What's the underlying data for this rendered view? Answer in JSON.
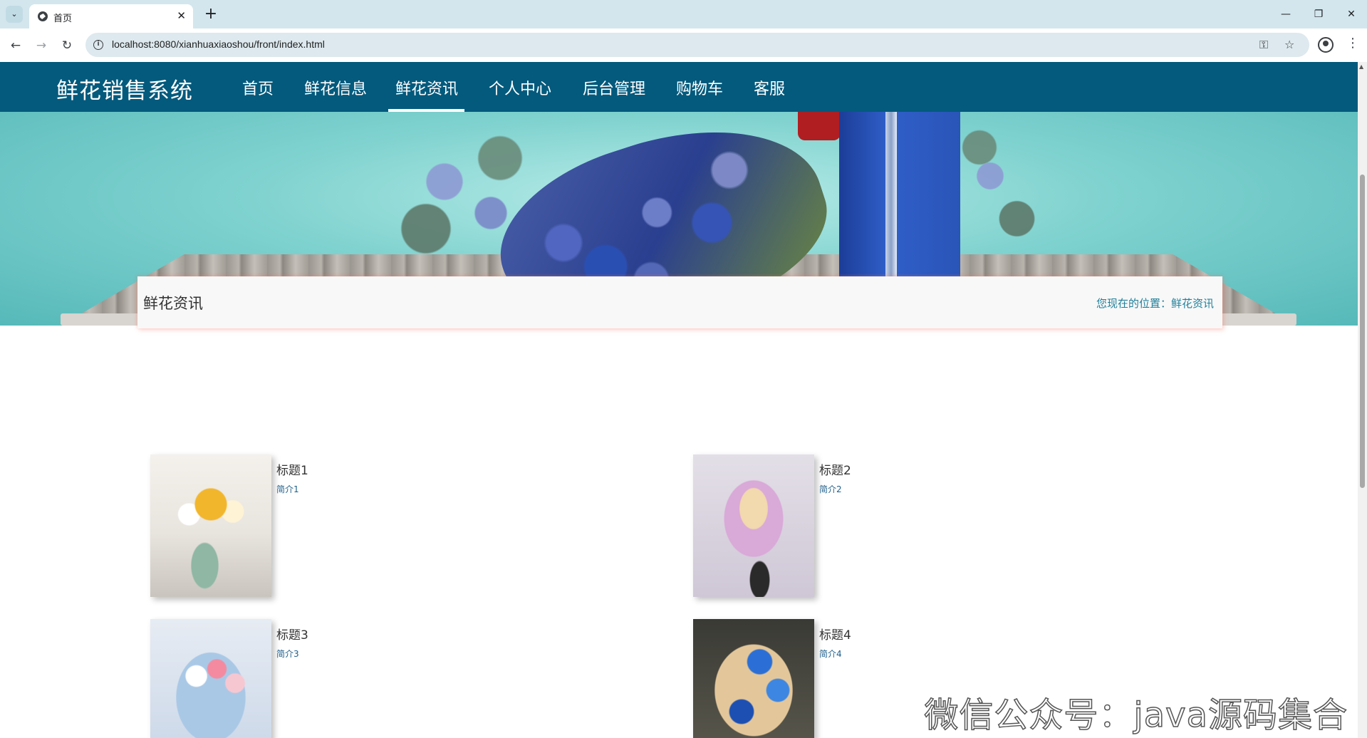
{
  "browser": {
    "tab_title": "首页",
    "url": "localhost:8080/xianhuaxiaoshou/front/index.html"
  },
  "site": {
    "brand": "鲜花销售系统",
    "nav": [
      {
        "label": "首页"
      },
      {
        "label": "鲜花信息"
      },
      {
        "label": "鲜花资讯"
      },
      {
        "label": "个人中心"
      },
      {
        "label": "后台管理"
      },
      {
        "label": "购物车"
      },
      {
        "label": "客服"
      }
    ],
    "active_nav": "鲜花资讯"
  },
  "breadcrumb": {
    "title": "鲜花资讯",
    "path": "您现在的位置：鲜花资讯"
  },
  "news": [
    {
      "title": "标题1",
      "intro": "简介1"
    },
    {
      "title": "标题2",
      "intro": "简介2"
    },
    {
      "title": "标题3",
      "intro": "简介3"
    },
    {
      "title": "标题4",
      "intro": "简介4"
    }
  ],
  "watermark": "微信公众号：java源码集合",
  "colors": {
    "nav_bg": "#035a7d",
    "breadcrumb_link": "#1f7f9a",
    "intro_text": "#1f5f8a"
  }
}
